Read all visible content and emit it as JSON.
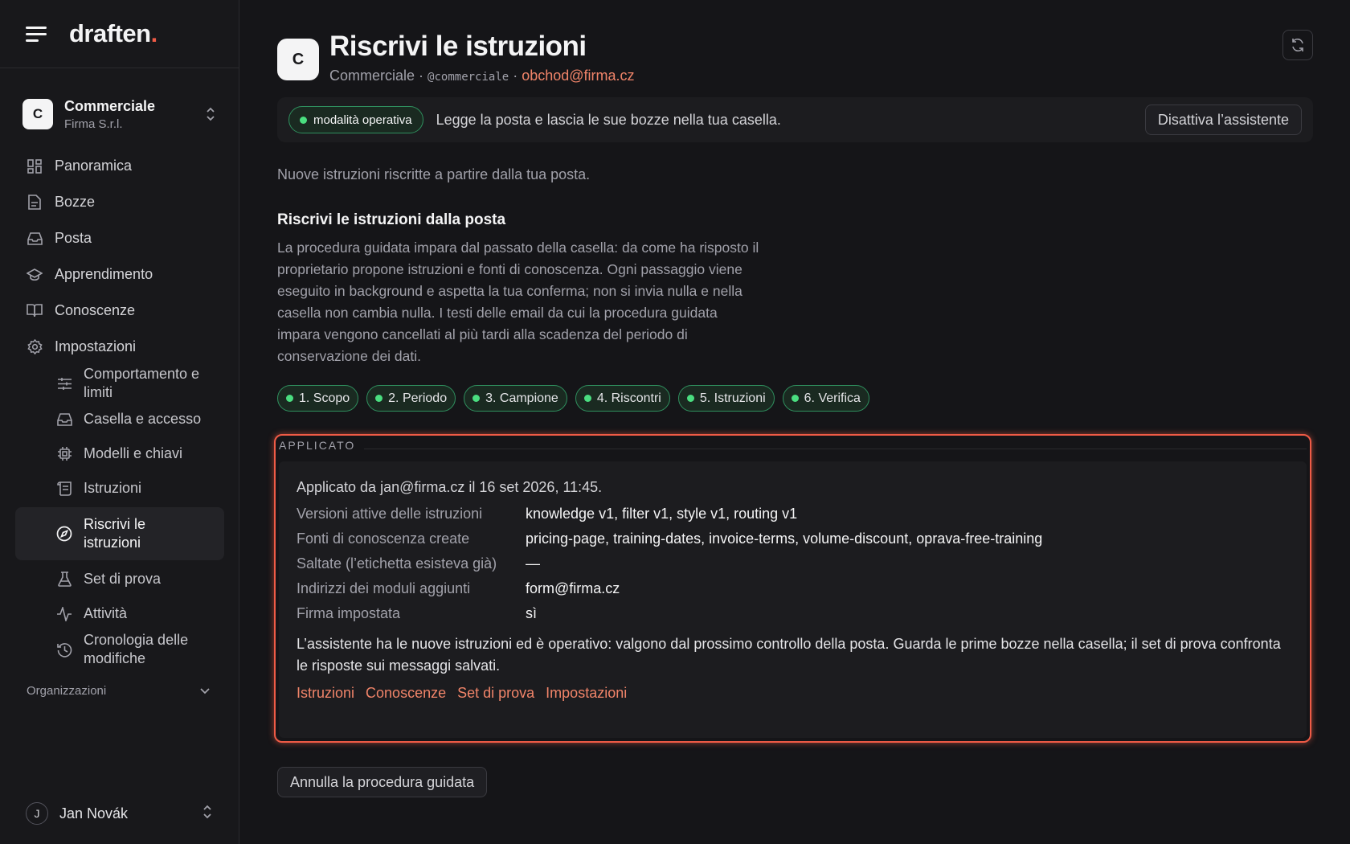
{
  "brand": {
    "logo_text": "draften",
    "logo_dot": "."
  },
  "workspace": {
    "initial": "C",
    "name": "Commerciale",
    "company": "Firma S.r.l."
  },
  "nav": [
    {
      "label": "Panoramica",
      "icon": "grid-icon"
    },
    {
      "label": "Bozze",
      "icon": "document-icon"
    },
    {
      "label": "Posta",
      "icon": "inbox-icon"
    },
    {
      "label": "Apprendimento",
      "icon": "graduation-cap-icon"
    },
    {
      "label": "Conoscenze",
      "icon": "book-icon"
    },
    {
      "label": "Impostazioni",
      "icon": "gear-icon"
    }
  ],
  "subnav": [
    {
      "label": "Comportamento e limiti",
      "icon": "sliders-icon"
    },
    {
      "label": "Casella e accesso",
      "icon": "inbox-icon"
    },
    {
      "label": "Modelli e chiavi",
      "icon": "chip-icon"
    },
    {
      "label": "Istruzioni",
      "icon": "scroll-icon"
    },
    {
      "label": "Riscrivi le istruzioni",
      "icon": "compass-icon"
    },
    {
      "label": "Set di prova",
      "icon": "flask-icon"
    },
    {
      "label": "Attività",
      "icon": "activity-icon"
    },
    {
      "label": "Cronologia delle modifiche",
      "icon": "history-icon"
    }
  ],
  "orgs_label": "Organizzazioni",
  "user": {
    "initial": "J",
    "name": "Jan Novák"
  },
  "header": {
    "avatar": "C",
    "title": "Riscrivi le istruzioni",
    "team": "Commerciale ·",
    "handle": "@commerciale",
    "sep": "·",
    "email": "obchod@firma.cz"
  },
  "status": {
    "pill": "modalità operativa",
    "text": "Legge la posta e lascia le sue bozze nella tua casella.",
    "button": "Disattiva l’assistente"
  },
  "intro": "Nuove istruzioni riscritte a partire dalla tua posta.",
  "section": {
    "title": "Riscrivi le istruzioni dalla posta",
    "description": "La procedura guidata impara dal passato della casella: da come ha risposto il proprietario propone istruzioni e fonti di conoscenza. Ogni passaggio viene eseguito in background e aspetta la tua conferma; non si invia nulla e nella casella non cambia nulla. I testi delle email da cui la procedura guidata impara vengono cancellati al più tardi alla scadenza del periodo di conservazione dei dati."
  },
  "steps": [
    "1. Scopo",
    "2. Periodo",
    "3. Campione",
    "4. Riscontri",
    "5. Istruzioni",
    "6. Verifica"
  ],
  "applied": {
    "label": "APPLICATO",
    "head": "Applicato da jan@firma.cz il 16 set 2026, 11:45.",
    "rows": [
      {
        "k": "Versioni attive delle istruzioni",
        "v": "knowledge v1, filter v1, style v1, routing v1"
      },
      {
        "k": "Fonti di conoscenza create",
        "v": "pricing-page, training-dates, invoice-terms, volume-discount, oprava-free-training"
      },
      {
        "k": "Saltate (l’etichetta esisteva già)",
        "v": "—"
      },
      {
        "k": "Indirizzi dei moduli aggiunti",
        "v": "form@firma.cz"
      },
      {
        "k": "Firma impostata",
        "v": "sì"
      }
    ],
    "note": "L’assistente ha le nuove istruzioni ed è operativo: valgono dal prossimo controllo della posta. Guarda le prime bozze nella casella; il set di prova confronta le risposte sui messaggi salvati.",
    "links": [
      "Istruzioni",
      "Conoscenze",
      "Set di prova",
      "Impostazioni"
    ]
  },
  "cancel_button": "Annulla la procedura guidata",
  "colors": {
    "accent": "#ef5b46",
    "link": "#f08469",
    "success": "#4ade80",
    "background": "#151518"
  }
}
